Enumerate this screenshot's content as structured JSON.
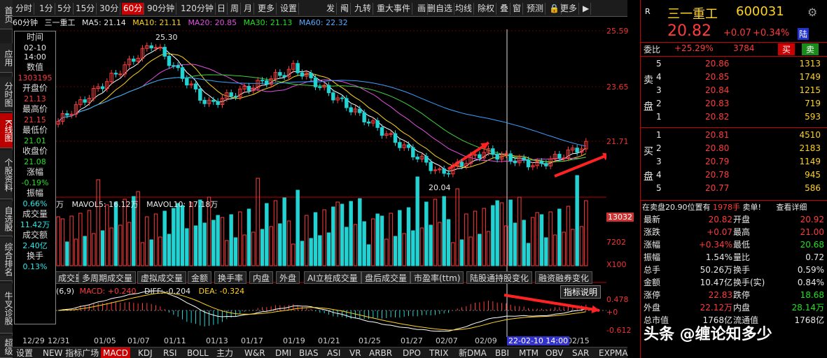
{
  "side_tabs": [
    "首页",
    "应用",
    "分时图",
    "K线图",
    "个股资料",
    "自选股",
    "综合排名",
    "牛叉诊股",
    "超级"
  ],
  "toolbar": {
    "left": [
      "分时",
      "1分",
      "5分",
      "15分",
      "30分",
      "60分",
      "90分钟",
      "120分钟",
      "日",
      "周",
      "月",
      "更多",
      "设置"
    ],
    "right": [
      "发",
      "阄",
      "九转",
      "重大事件",
      "画",
      "删自选",
      "均线",
      "除权",
      "叠",
      "窗",
      "预测",
      "🔒",
      "更多",
      "▶"
    ]
  },
  "info": {
    "period": "60分钟",
    "name": "三一重工",
    "ma5": "MA5: 21.14",
    "ma10": "MA10: 21.11",
    "ma20": "MA20: 20.85",
    "ma30": "MA30: 21.13",
    "ma60": "MA60: 22.32"
  },
  "tooltip": {
    "time_label": "时间",
    "date": "02-10",
    "time": "14:00",
    "value_label": "数值",
    "value": "1303195",
    "open_label": "开盘价",
    "open": "21.13",
    "high_label": "最高价",
    "high": "21.15",
    "low_label": "最低价",
    "low": "21.01",
    "close_label": "收盘价",
    "close": "21.08",
    "chg_label": "涨幅",
    "chg": "-0.19%",
    "amp_label": "振幅",
    "amp": "0.66%",
    "vol_label": "成交量",
    "vol": "11.42万",
    "amt_label": "成交额",
    "amt": "2.40亿",
    "turn_label": "换手",
    "turn": "0.13%"
  },
  "price_axis": [
    "25.59",
    "23.65",
    "21.71",
    "",
    "",
    "20.04",
    "25.30"
  ],
  "vol_info": {
    "unit": "万",
    "mavol5": "MAVOL5: 16.12万",
    "mavol10": "MAVOL10: 17.18万",
    "axis_top": "13032",
    "axis_mid": "7202",
    "axis_bot": "X100"
  },
  "menu_tabs": [
    "成交量",
    "多周期成交量",
    "虚拟成交量",
    "金额",
    "换手率",
    "内盘",
    "外盘",
    "AI立桩成交量",
    "盘后成交量",
    "市盈率(ttm)",
    "陆股通持股变化",
    "融资融券变化"
  ],
  "macd": {
    "label": "(6,9)",
    "macd": "MACD: +0.240",
    "diff": "DIFF: -0.204",
    "dea": "DEA: -0.324",
    "btn": "指标说明",
    "axis_top": "0.478",
    "axis_mid": "+0",
    "axis_bot": "-0.612"
  },
  "x_axis": [
    "12/29",
    "12/31",
    "01/05",
    "01/07",
    "01/11",
    "01/13",
    "01/17",
    "01/19",
    "01/21",
    "01/25",
    "01/27",
    "02/07",
    "02/09",
    "02/15"
  ],
  "cursor_time": "22-02-10 14:00",
  "bottom_tabs": [
    "设置",
    "NEW 指标广场",
    "MACD",
    "KDJ",
    "RSI",
    "BOLL",
    "主力",
    "W&R",
    "DMI",
    "BIAS",
    "ASI",
    "VR",
    "ARBR",
    "DPO",
    "TRIX",
    "新DMA",
    "BBI",
    "MTM",
    "OBV",
    "SAR",
    "EXPMA"
  ],
  "quote": {
    "flag": "R",
    "name": "三一重工",
    "code": "600031",
    "price": "20.82",
    "chg": "+0.07",
    "pct": "+0.34%",
    "market": "陆",
    "weibi_label": "委比",
    "weibi": "+25.29%",
    "weicha": "3784",
    "buy_btn": "买",
    "sell_btn": "卖"
  },
  "sell_label": [
    "卖",
    "盘"
  ],
  "buy_label": [
    "买",
    "盘"
  ],
  "asks": [
    {
      "n": "5",
      "p": "20.86",
      "v": "1313"
    },
    {
      "n": "4",
      "p": "20.85",
      "v": "1749"
    },
    {
      "n": "3",
      "p": "20.84",
      "v": "1215"
    },
    {
      "n": "2",
      "p": "20.83",
      "v": "719"
    },
    {
      "n": "1",
      "p": "20.82",
      "v": "593"
    }
  ],
  "bids": [
    {
      "n": "1",
      "p": "20.81",
      "v": "4510"
    },
    {
      "n": "2",
      "p": "20.80",
      "v": "2183"
    },
    {
      "n": "3",
      "p": "20.79",
      "v": "1149"
    },
    {
      "n": "4",
      "p": "20.78",
      "v": "945"
    },
    {
      "n": "5",
      "p": "20.77",
      "v": "586"
    }
  ],
  "trade_bar": {
    "text": "在卖盘20.90位置有",
    "qty": "1978手",
    "tag": "卖单!",
    "detail": "查看详细"
  },
  "stats": [
    {
      "l": "最新",
      "v": "20.82",
      "l2": "开盘",
      "v2": "20.92"
    },
    {
      "l": "涨跌",
      "v": "+0.07",
      "l2": "最高",
      "v2": "21.00"
    },
    {
      "l": "涨幅",
      "v": "+0.34%",
      "l2": "最低",
      "v2": "20.68"
    },
    {
      "l": "振幅",
      "v": "1.54%",
      "l2": "量比",
      "v2": "0.72"
    },
    {
      "l": "总手",
      "v": "50.26万",
      "l2": "换手",
      "v2": "0.59%"
    },
    {
      "l": "金额",
      "v": "10.47亿",
      "l2": "换手(实)",
      "v2": "0.84%"
    },
    {
      "l": "涨停",
      "v": "22.83",
      "l2": "跌停",
      "v2": "18.68"
    },
    {
      "l": "外盘",
      "v": "22.12万",
      "l2": "内盘",
      "v2": "28.14万"
    },
    {
      "l": "总市值",
      "v": "1768亿",
      "l2": "流通值",
      "v2": "1768亿"
    }
  ],
  "watermark": "头条 @缠论知多少",
  "colors": {
    "up": "#ff3b3b",
    "down": "#22d3d3",
    "ma5": "#ffffff",
    "ma10": "#ffd21e",
    "ma20": "#e050e0",
    "ma30": "#3cd23c",
    "ma60": "#3aa0ff"
  }
}
